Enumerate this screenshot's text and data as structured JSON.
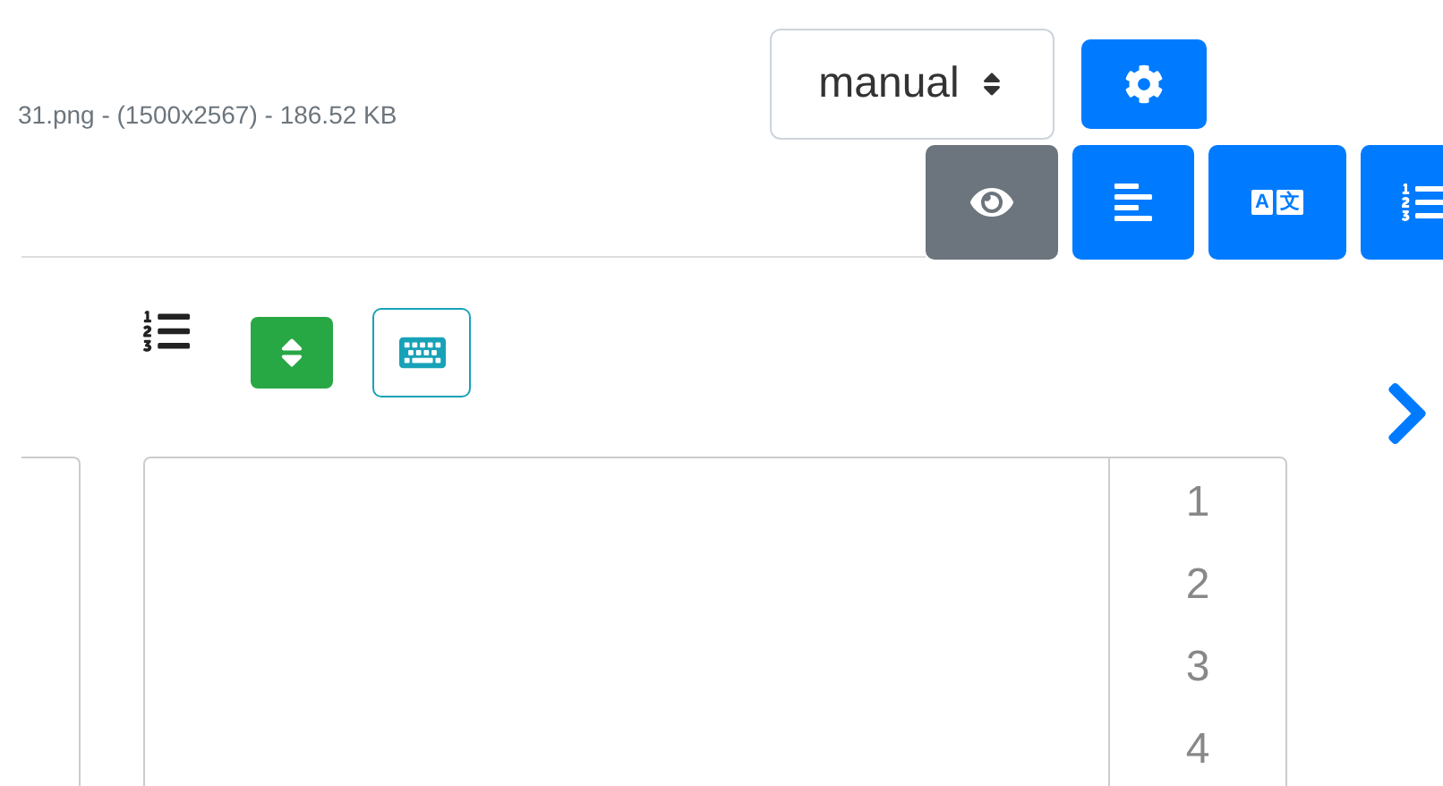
{
  "file_info": "31.png - (1500x2567) - 186.52 KB",
  "mode_select": {
    "value": "manual"
  },
  "view_buttons": [
    {
      "kind": "preview",
      "active": true
    },
    {
      "kind": "align",
      "active": false
    },
    {
      "kind": "translate",
      "active": false,
      "glyphs": [
        "A",
        "文"
      ]
    },
    {
      "kind": "numbered-list",
      "active": false
    }
  ],
  "editor": {
    "line_numbers": [
      "1",
      "2",
      "3",
      "4"
    ]
  }
}
